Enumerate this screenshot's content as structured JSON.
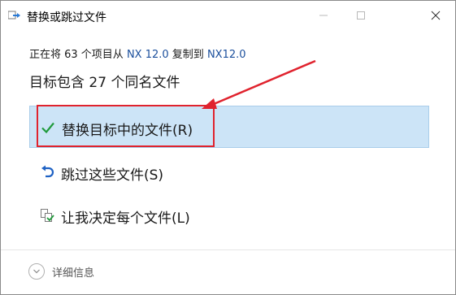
{
  "window": {
    "title": "替换或跳过文件"
  },
  "copy_info": {
    "prefix": "正在将 63 个项目从 ",
    "source": "NX 12.0",
    "middle": " 复制到 ",
    "destination": "NX12.0"
  },
  "heading": "目标包含 27 个同名文件",
  "options": {
    "replace": "替换目标中的文件(R)",
    "skip": "跳过这些文件(S)",
    "decide": "让我决定每个文件(L)"
  },
  "details_label": "详细信息",
  "colors": {
    "selected_bg": "#cce4f7",
    "annotation_red": "#e0232e",
    "link_blue": "#1b4f9c",
    "check_green": "#1f9a3b"
  }
}
